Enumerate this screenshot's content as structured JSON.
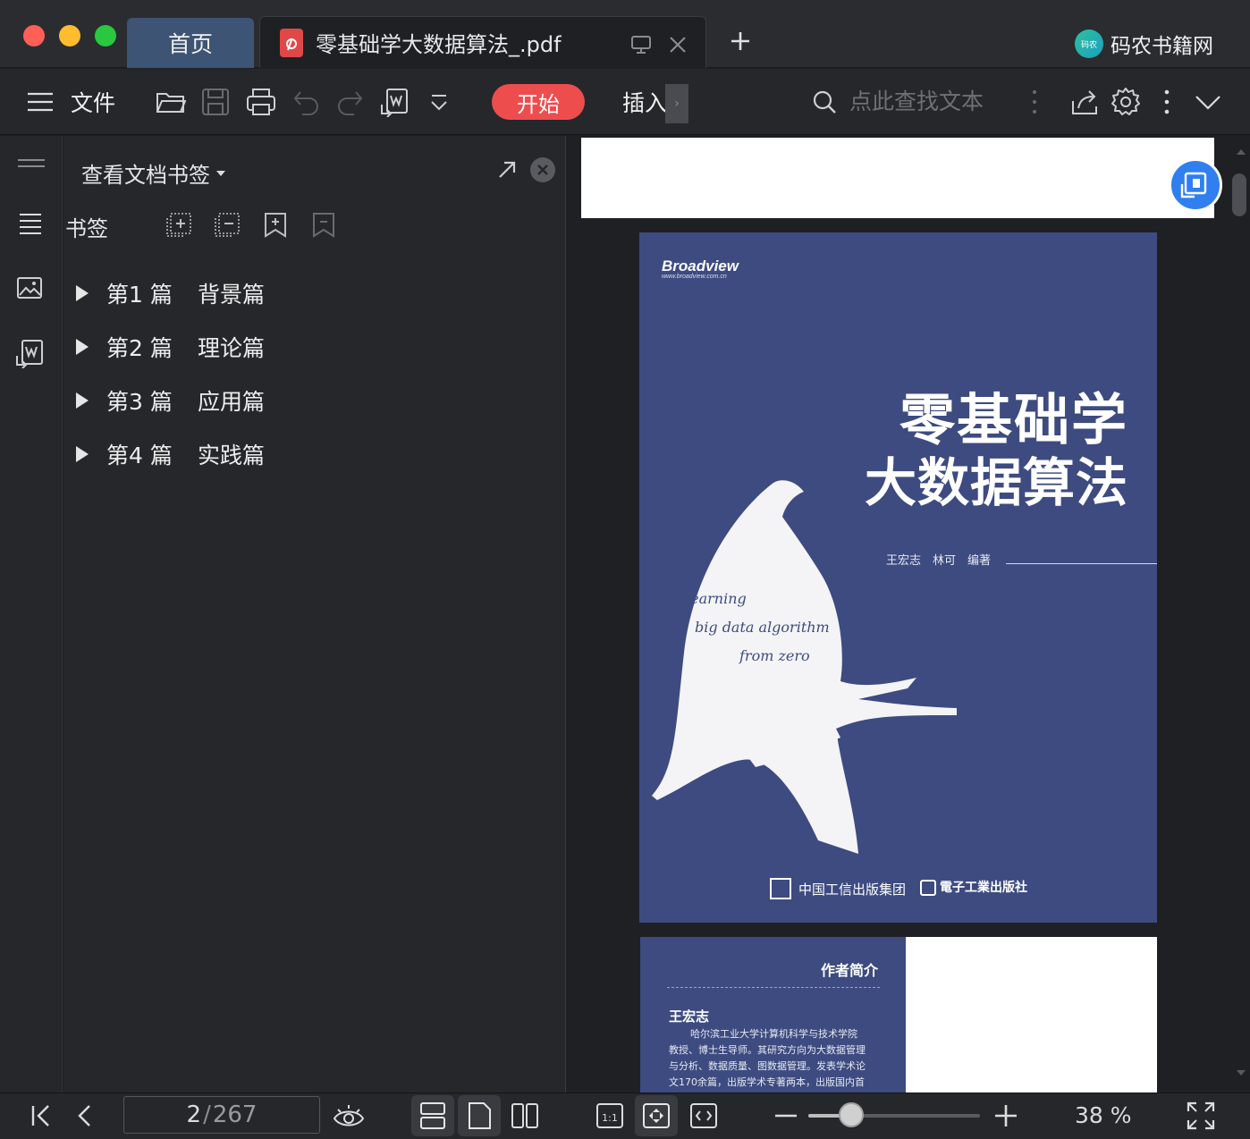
{
  "window": {
    "tabs": [
      {
        "label": "首页",
        "active": false
      },
      {
        "label": "零基础学大数据算法_.pdf",
        "active": true
      }
    ],
    "brand": {
      "logo_text": "码农",
      "name": "码农书籍网"
    }
  },
  "toolbar": {
    "file_label": "文件",
    "start_label": "开始",
    "insert_label": "插入",
    "search_placeholder": "点此查找文本",
    "accent": "#ee4d4d"
  },
  "bookmarks_panel": {
    "title": "查看文档书签",
    "section_label": "书签",
    "items": [
      {
        "num": "第1 篇",
        "title": "背景篇"
      },
      {
        "num": "第2 篇",
        "title": "理论篇"
      },
      {
        "num": "第3 篇",
        "title": "应用篇"
      },
      {
        "num": "第4 篇",
        "title": "实践篇"
      }
    ]
  },
  "document": {
    "cover": {
      "publisher_brand": "Broadview",
      "publisher_url": "www.broadview.com.cn",
      "title_line1": "零基础学",
      "title_line2": "大数据算法",
      "authors": "王宏志　林可　编著",
      "script_line1": "learning",
      "script_line2": "big data algorithm",
      "script_line3": "from zero",
      "group_name": "中国工信出版集团",
      "press_name": "電子工業出版社",
      "cover_color": "#3d4b80"
    },
    "intro_page": {
      "heading": "作者简介",
      "author": "王宏志",
      "text_lines": [
        "哈尔滨工业大学计算机科学与技术学院",
        "教授、博士生导师。其研究方向为大数据管理",
        "与分析、数据质量、图数据管理。发表学术论",
        "文170余篇，出版学术专著两本，出版国内首"
      ]
    }
  },
  "status": {
    "current_page": "2",
    "total_pages": "267",
    "zoom": 0.38,
    "zoom_label": "38 %"
  }
}
